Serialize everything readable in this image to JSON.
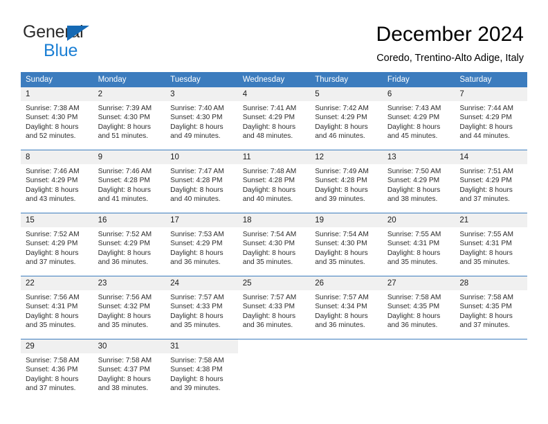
{
  "brand": {
    "line1": "General",
    "line2": "Blue",
    "triangle_color": "#1569b4",
    "blue_text_color": "#1b7fd4"
  },
  "header": {
    "title": "December 2024",
    "subtitle": "Coredo, Trentino-Alto Adige, Italy"
  },
  "colors": {
    "header_row_background": "#3c7cbe",
    "header_row_text": "#ffffff",
    "daynum_background": "#f0f0f0",
    "row_divider": "#3c7cbe",
    "body_text": "#2c2c2c"
  },
  "weekday_headers": [
    "Sunday",
    "Monday",
    "Tuesday",
    "Wednesday",
    "Thursday",
    "Friday",
    "Saturday"
  ],
  "weeks": [
    [
      {
        "day": "1",
        "sunrise": "Sunrise: 7:38 AM",
        "sunset": "Sunset: 4:30 PM",
        "daylight1": "Daylight: 8 hours",
        "daylight2": "and 52 minutes."
      },
      {
        "day": "2",
        "sunrise": "Sunrise: 7:39 AM",
        "sunset": "Sunset: 4:30 PM",
        "daylight1": "Daylight: 8 hours",
        "daylight2": "and 51 minutes."
      },
      {
        "day": "3",
        "sunrise": "Sunrise: 7:40 AM",
        "sunset": "Sunset: 4:30 PM",
        "daylight1": "Daylight: 8 hours",
        "daylight2": "and 49 minutes."
      },
      {
        "day": "4",
        "sunrise": "Sunrise: 7:41 AM",
        "sunset": "Sunset: 4:29 PM",
        "daylight1": "Daylight: 8 hours",
        "daylight2": "and 48 minutes."
      },
      {
        "day": "5",
        "sunrise": "Sunrise: 7:42 AM",
        "sunset": "Sunset: 4:29 PM",
        "daylight1": "Daylight: 8 hours",
        "daylight2": "and 46 minutes."
      },
      {
        "day": "6",
        "sunrise": "Sunrise: 7:43 AM",
        "sunset": "Sunset: 4:29 PM",
        "daylight1": "Daylight: 8 hours",
        "daylight2": "and 45 minutes."
      },
      {
        "day": "7",
        "sunrise": "Sunrise: 7:44 AM",
        "sunset": "Sunset: 4:29 PM",
        "daylight1": "Daylight: 8 hours",
        "daylight2": "and 44 minutes."
      }
    ],
    [
      {
        "day": "8",
        "sunrise": "Sunrise: 7:46 AM",
        "sunset": "Sunset: 4:29 PM",
        "daylight1": "Daylight: 8 hours",
        "daylight2": "and 43 minutes."
      },
      {
        "day": "9",
        "sunrise": "Sunrise: 7:46 AM",
        "sunset": "Sunset: 4:28 PM",
        "daylight1": "Daylight: 8 hours",
        "daylight2": "and 41 minutes."
      },
      {
        "day": "10",
        "sunrise": "Sunrise: 7:47 AM",
        "sunset": "Sunset: 4:28 PM",
        "daylight1": "Daylight: 8 hours",
        "daylight2": "and 40 minutes."
      },
      {
        "day": "11",
        "sunrise": "Sunrise: 7:48 AM",
        "sunset": "Sunset: 4:28 PM",
        "daylight1": "Daylight: 8 hours",
        "daylight2": "and 40 minutes."
      },
      {
        "day": "12",
        "sunrise": "Sunrise: 7:49 AM",
        "sunset": "Sunset: 4:28 PM",
        "daylight1": "Daylight: 8 hours",
        "daylight2": "and 39 minutes."
      },
      {
        "day": "13",
        "sunrise": "Sunrise: 7:50 AM",
        "sunset": "Sunset: 4:29 PM",
        "daylight1": "Daylight: 8 hours",
        "daylight2": "and 38 minutes."
      },
      {
        "day": "14",
        "sunrise": "Sunrise: 7:51 AM",
        "sunset": "Sunset: 4:29 PM",
        "daylight1": "Daylight: 8 hours",
        "daylight2": "and 37 minutes."
      }
    ],
    [
      {
        "day": "15",
        "sunrise": "Sunrise: 7:52 AM",
        "sunset": "Sunset: 4:29 PM",
        "daylight1": "Daylight: 8 hours",
        "daylight2": "and 37 minutes."
      },
      {
        "day": "16",
        "sunrise": "Sunrise: 7:52 AM",
        "sunset": "Sunset: 4:29 PM",
        "daylight1": "Daylight: 8 hours",
        "daylight2": "and 36 minutes."
      },
      {
        "day": "17",
        "sunrise": "Sunrise: 7:53 AM",
        "sunset": "Sunset: 4:29 PM",
        "daylight1": "Daylight: 8 hours",
        "daylight2": "and 36 minutes."
      },
      {
        "day": "18",
        "sunrise": "Sunrise: 7:54 AM",
        "sunset": "Sunset: 4:30 PM",
        "daylight1": "Daylight: 8 hours",
        "daylight2": "and 35 minutes."
      },
      {
        "day": "19",
        "sunrise": "Sunrise: 7:54 AM",
        "sunset": "Sunset: 4:30 PM",
        "daylight1": "Daylight: 8 hours",
        "daylight2": "and 35 minutes."
      },
      {
        "day": "20",
        "sunrise": "Sunrise: 7:55 AM",
        "sunset": "Sunset: 4:31 PM",
        "daylight1": "Daylight: 8 hours",
        "daylight2": "and 35 minutes."
      },
      {
        "day": "21",
        "sunrise": "Sunrise: 7:55 AM",
        "sunset": "Sunset: 4:31 PM",
        "daylight1": "Daylight: 8 hours",
        "daylight2": "and 35 minutes."
      }
    ],
    [
      {
        "day": "22",
        "sunrise": "Sunrise: 7:56 AM",
        "sunset": "Sunset: 4:31 PM",
        "daylight1": "Daylight: 8 hours",
        "daylight2": "and 35 minutes."
      },
      {
        "day": "23",
        "sunrise": "Sunrise: 7:56 AM",
        "sunset": "Sunset: 4:32 PM",
        "daylight1": "Daylight: 8 hours",
        "daylight2": "and 35 minutes."
      },
      {
        "day": "24",
        "sunrise": "Sunrise: 7:57 AM",
        "sunset": "Sunset: 4:33 PM",
        "daylight1": "Daylight: 8 hours",
        "daylight2": "and 35 minutes."
      },
      {
        "day": "25",
        "sunrise": "Sunrise: 7:57 AM",
        "sunset": "Sunset: 4:33 PM",
        "daylight1": "Daylight: 8 hours",
        "daylight2": "and 36 minutes."
      },
      {
        "day": "26",
        "sunrise": "Sunrise: 7:57 AM",
        "sunset": "Sunset: 4:34 PM",
        "daylight1": "Daylight: 8 hours",
        "daylight2": "and 36 minutes."
      },
      {
        "day": "27",
        "sunrise": "Sunrise: 7:58 AM",
        "sunset": "Sunset: 4:35 PM",
        "daylight1": "Daylight: 8 hours",
        "daylight2": "and 36 minutes."
      },
      {
        "day": "28",
        "sunrise": "Sunrise: 7:58 AM",
        "sunset": "Sunset: 4:35 PM",
        "daylight1": "Daylight: 8 hours",
        "daylight2": "and 37 minutes."
      }
    ],
    [
      {
        "day": "29",
        "sunrise": "Sunrise: 7:58 AM",
        "sunset": "Sunset: 4:36 PM",
        "daylight1": "Daylight: 8 hours",
        "daylight2": "and 37 minutes."
      },
      {
        "day": "30",
        "sunrise": "Sunrise: 7:58 AM",
        "sunset": "Sunset: 4:37 PM",
        "daylight1": "Daylight: 8 hours",
        "daylight2": "and 38 minutes."
      },
      {
        "day": "31",
        "sunrise": "Sunrise: 7:58 AM",
        "sunset": "Sunset: 4:38 PM",
        "daylight1": "Daylight: 8 hours",
        "daylight2": "and 39 minutes."
      },
      {
        "day": "",
        "sunrise": "",
        "sunset": "",
        "daylight1": "",
        "daylight2": ""
      },
      {
        "day": "",
        "sunrise": "",
        "sunset": "",
        "daylight1": "",
        "daylight2": ""
      },
      {
        "day": "",
        "sunrise": "",
        "sunset": "",
        "daylight1": "",
        "daylight2": ""
      },
      {
        "day": "",
        "sunrise": "",
        "sunset": "",
        "daylight1": "",
        "daylight2": ""
      }
    ]
  ]
}
